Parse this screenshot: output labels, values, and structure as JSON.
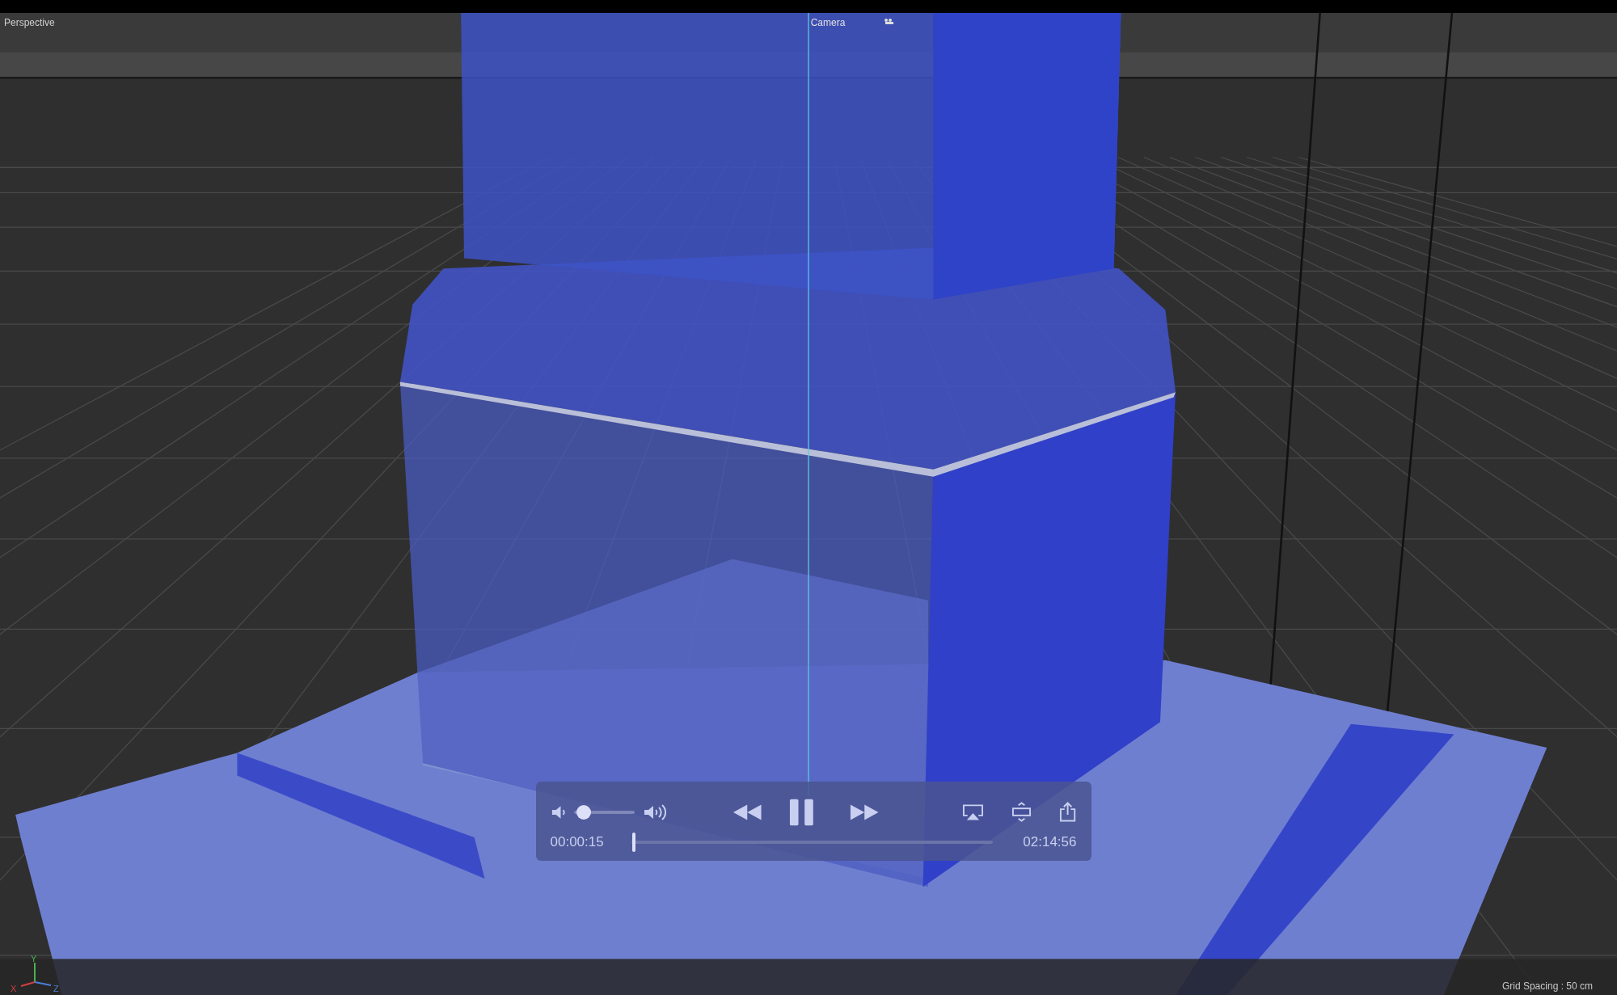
{
  "viewport": {
    "view_name": "Perspective",
    "camera_label": "Camera",
    "axes": [
      "X",
      "Y",
      "Z"
    ],
    "grid_spacing": "Grid Spacing : 50 cm"
  },
  "player": {
    "playing": true,
    "volume": {
      "level": 0.06
    },
    "elapsed": "00:00:15",
    "duration": "02:14:56",
    "progress": {
      "level": 0.003
    }
  }
}
